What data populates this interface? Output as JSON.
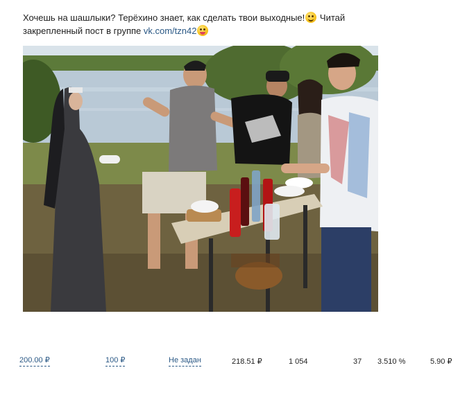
{
  "post": {
    "text_line1": "Хочешь на шашлыки? Терёхино знает, как сделать твои выходные!",
    "text_line1b": "Читай",
    "text_line2": "закрепленный пост в группе",
    "link": "vk.com/tzn42",
    "emoji_1": "wink-face-icon",
    "emoji_2": "tongue-face-icon"
  },
  "photo": {
    "subject": "people-at-picnic-by-river-photo"
  },
  "stats": {
    "budget": "200.00 ₽",
    "limit": "100 ₽",
    "not_set": "Не задан",
    "spent": "218.51 ₽",
    "impressions": "1 054",
    "clicks": "37",
    "ctr": "3.510 %",
    "cpc": "5.90 ₽"
  }
}
